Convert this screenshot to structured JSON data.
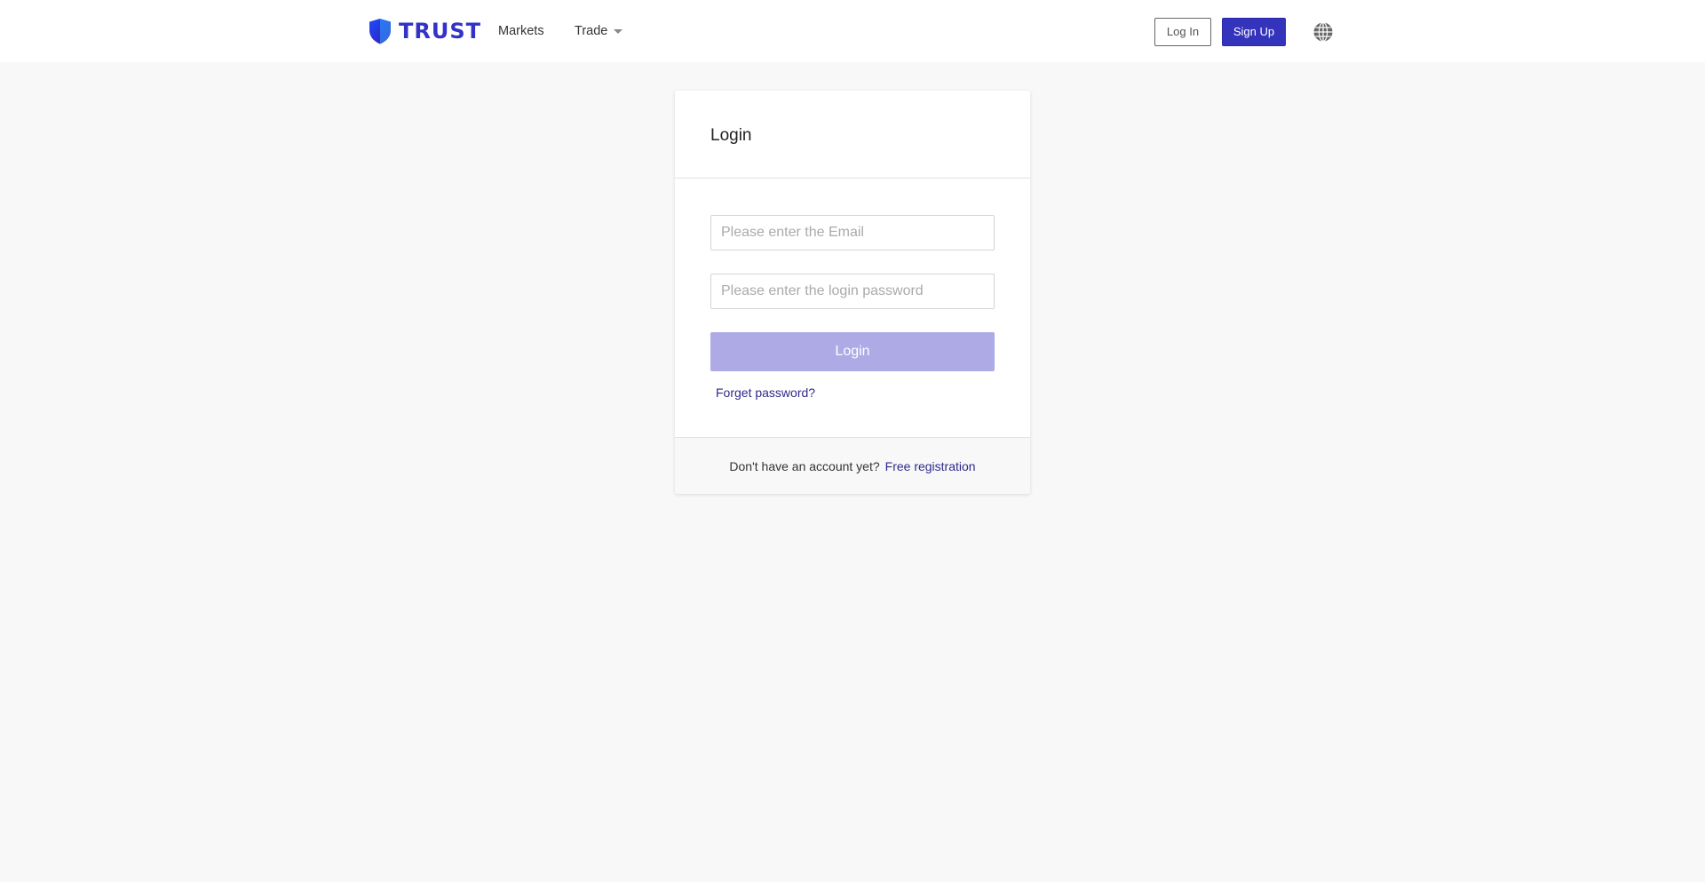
{
  "header": {
    "logo_text": "TRUST",
    "nav": {
      "markets": "Markets",
      "trade": "Trade"
    },
    "login_button": "Log In",
    "signup_button": "Sign Up",
    "language_icon": "globe-icon"
  },
  "login_card": {
    "title": "Login",
    "email_placeholder": "Please enter the Email",
    "password_placeholder": "Please enter the login password",
    "submit_label": "Login",
    "forget_password": "Forget password?",
    "footer_text": "Don't have an account yet?",
    "footer_link": "Free registration"
  },
  "colors": {
    "brand": "#3333bb",
    "button_disabled": "#adaae6",
    "link": "#2e2a8c",
    "page_background": "#f8f8f8"
  }
}
